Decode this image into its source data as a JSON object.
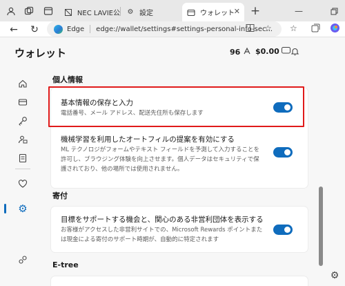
{
  "tabs": [
    {
      "label": "NEC LAVIE公",
      "icon": "document-icon"
    },
    {
      "label": "設定",
      "icon": "gear-icon"
    },
    {
      "label": "ウォレット",
      "icon": "wallet-icon",
      "active": true
    }
  ],
  "address": {
    "site": "Edge",
    "url": "edge://wallet/settings#settings-personal-info-sec..."
  },
  "page": {
    "title": "ウォレット",
    "points": "96",
    "balance": "$0.00"
  },
  "sections": {
    "personal": {
      "heading": "個人情報",
      "rows": [
        {
          "title": "基本情報の保存と入力",
          "desc": "電話番号、メール アドレス、配送先住所も保存します",
          "toggle": "on"
        },
        {
          "title": "機械学習を利用したオートフィルの提案を有効にする",
          "desc": "ML テクノロジがフォームやテキスト フィールドを予測して入力することを許可し、ブラウジング体験を向上させます。個人データはセキュリティで保護されており、他の場所では使用されません。",
          "toggle": "on"
        }
      ]
    },
    "donation": {
      "heading": "寄付",
      "rows": [
        {
          "title": "目標をサポートする機会と、関心のある非営利団体を表示する",
          "desc": "お客様がアクセスした非営利サイトでの、Microsoft Rewards ポイントまたは現金による寄付のサポート時期が、自動的に特定されます",
          "toggle": "on"
        }
      ]
    },
    "etree": {
      "heading": "E-tree"
    }
  },
  "colors": {
    "accent": "#0f6cbd",
    "highlight": "#e01a1a"
  }
}
